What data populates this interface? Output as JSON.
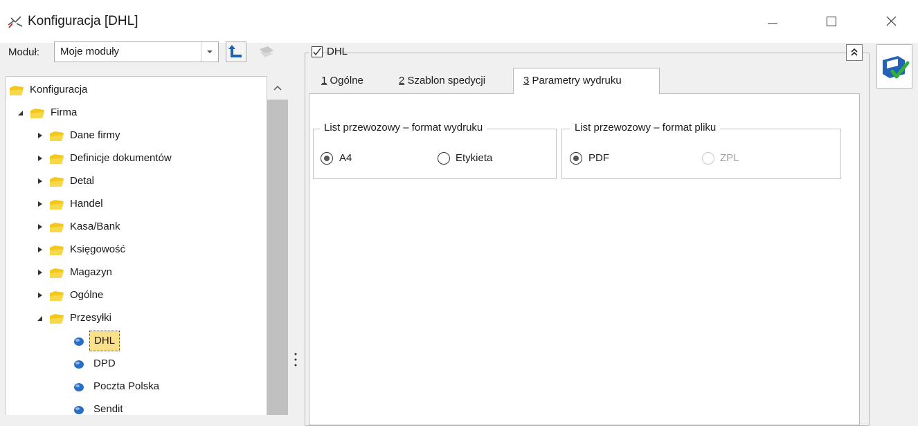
{
  "window": {
    "title": "Konfiguracja [DHL]"
  },
  "module": {
    "label": "Moduł:",
    "selected": "Moje moduły"
  },
  "tree": {
    "root": "Konfiguracja",
    "firma": "Firma",
    "items": [
      "Dane firmy",
      "Definicje dokumentów",
      "Detal",
      "Handel",
      "Kasa/Bank",
      "Księgowość",
      "Magazyn",
      "Ogólne",
      "Przesyłki"
    ],
    "carriers": [
      "DHL",
      "DPD",
      "Poczta Polska",
      "Sendit"
    ]
  },
  "group": {
    "label": "DHL",
    "checked": true
  },
  "tabs": [
    {
      "key": "1",
      "label": "Ogólne"
    },
    {
      "key": "2",
      "label": "Szablon spedycji"
    },
    {
      "key": "3",
      "label": "Parametry wydruku"
    }
  ],
  "print_format": {
    "legend": "List przewozowy – format wydruku",
    "options": [
      "A4",
      "Etykieta"
    ],
    "selected": "A4"
  },
  "file_format": {
    "legend": "List przewozowy – format pliku",
    "options": [
      "PDF",
      "ZPL"
    ],
    "selected": "PDF",
    "disabled": [
      "ZPL"
    ]
  },
  "colors": {
    "selection": "#fbe08b",
    "folder": "#f2c81a",
    "bullet": "#2b6fc4"
  }
}
